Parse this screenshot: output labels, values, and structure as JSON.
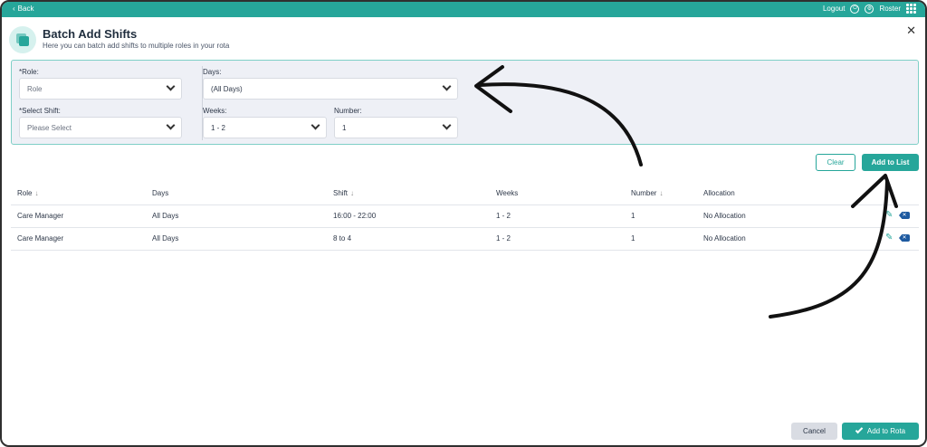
{
  "topbar": {
    "back_label": "Back",
    "logout_label": "Logout",
    "roster_label": "Roster"
  },
  "header": {
    "title": "Batch Add Shifts",
    "subtitle": "Here you can batch add shifts to multiple roles in your rota"
  },
  "filters": {
    "role": {
      "label": "*Role:",
      "value": "Role"
    },
    "select_shift": {
      "label": "*Select Shift:",
      "value": "Please Select"
    },
    "days": {
      "label": "Days:",
      "value": "(All Days)"
    },
    "weeks": {
      "label": "Weeks:",
      "value": "1 - 2"
    },
    "number": {
      "label": "Number:",
      "value": "1"
    }
  },
  "actions": {
    "clear_label": "Clear",
    "add_to_list_label": "Add to List",
    "cancel_label": "Cancel",
    "add_to_rota_label": "Add to Rota"
  },
  "table": {
    "headers": {
      "role": "Role",
      "days": "Days",
      "shift": "Shift",
      "weeks": "Weeks",
      "number": "Number",
      "allocation": "Allocation"
    },
    "rows": [
      {
        "role": "Care Manager",
        "days": "All Days",
        "shift": "16:00 - 22:00",
        "weeks": "1 - 2",
        "number": "1",
        "allocation": "No Allocation"
      },
      {
        "role": "Care Manager",
        "days": "All Days",
        "shift": "8 to 4",
        "weeks": "1 - 2",
        "number": "1",
        "allocation": "No Allocation"
      }
    ]
  },
  "colors": {
    "accent": "#26a69a",
    "delete": "#1e5aa0",
    "filter_bg": "#eef0f6"
  }
}
